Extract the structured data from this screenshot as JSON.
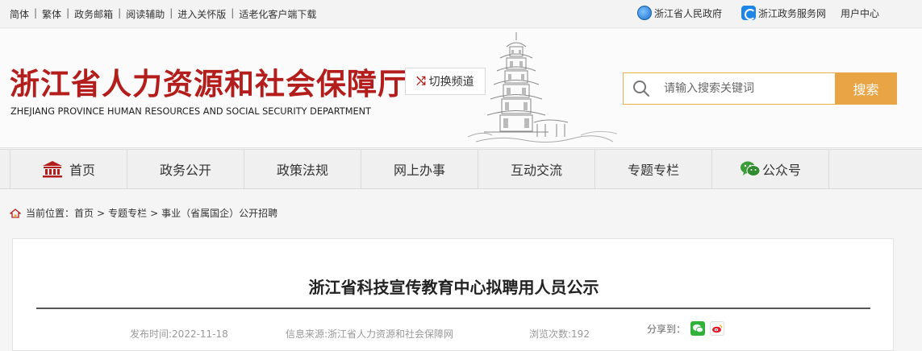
{
  "topbar": {
    "links": [
      "简体",
      "繁体",
      "政务邮箱",
      "阅读辅助",
      "进入关怀版",
      "适老化客户端下载"
    ],
    "right": {
      "gov_label": "浙江省人民政府",
      "service_label": "浙江政务服务网",
      "user_center": "用户中心"
    }
  },
  "header": {
    "logo_cn": "浙江省人力资源和社会保障厅",
    "logo_en": "ZHEJIANG PROVINCE HUMAN RESOURCES AND SOCIAL SECURITY DEPARTMENT",
    "switch_label": "切换频道",
    "search_placeholder": "请输入搜索关键词",
    "search_button": "搜索"
  },
  "nav": {
    "items": [
      "首页",
      "政务公开",
      "政策法规",
      "网上办事",
      "互动交流",
      "专题专栏",
      "公众号"
    ]
  },
  "breadcrumb": {
    "prefix": "当前位置：",
    "items": [
      "首页",
      "专题专栏",
      "事业（省属国企）公开招聘"
    ]
  },
  "article": {
    "title": "浙江省科技宣传教育中心拟聘用人员公示",
    "publish_time": "发布时间:2022-11-18",
    "source": "信息来源:浙江省人力资源和社会保障网",
    "views": "浏览次数:192",
    "share_label": "分享到："
  },
  "colors": {
    "brand_red": "#b31d1b",
    "search_orange": "#e9a445",
    "wechat_green": "#30b23a"
  }
}
